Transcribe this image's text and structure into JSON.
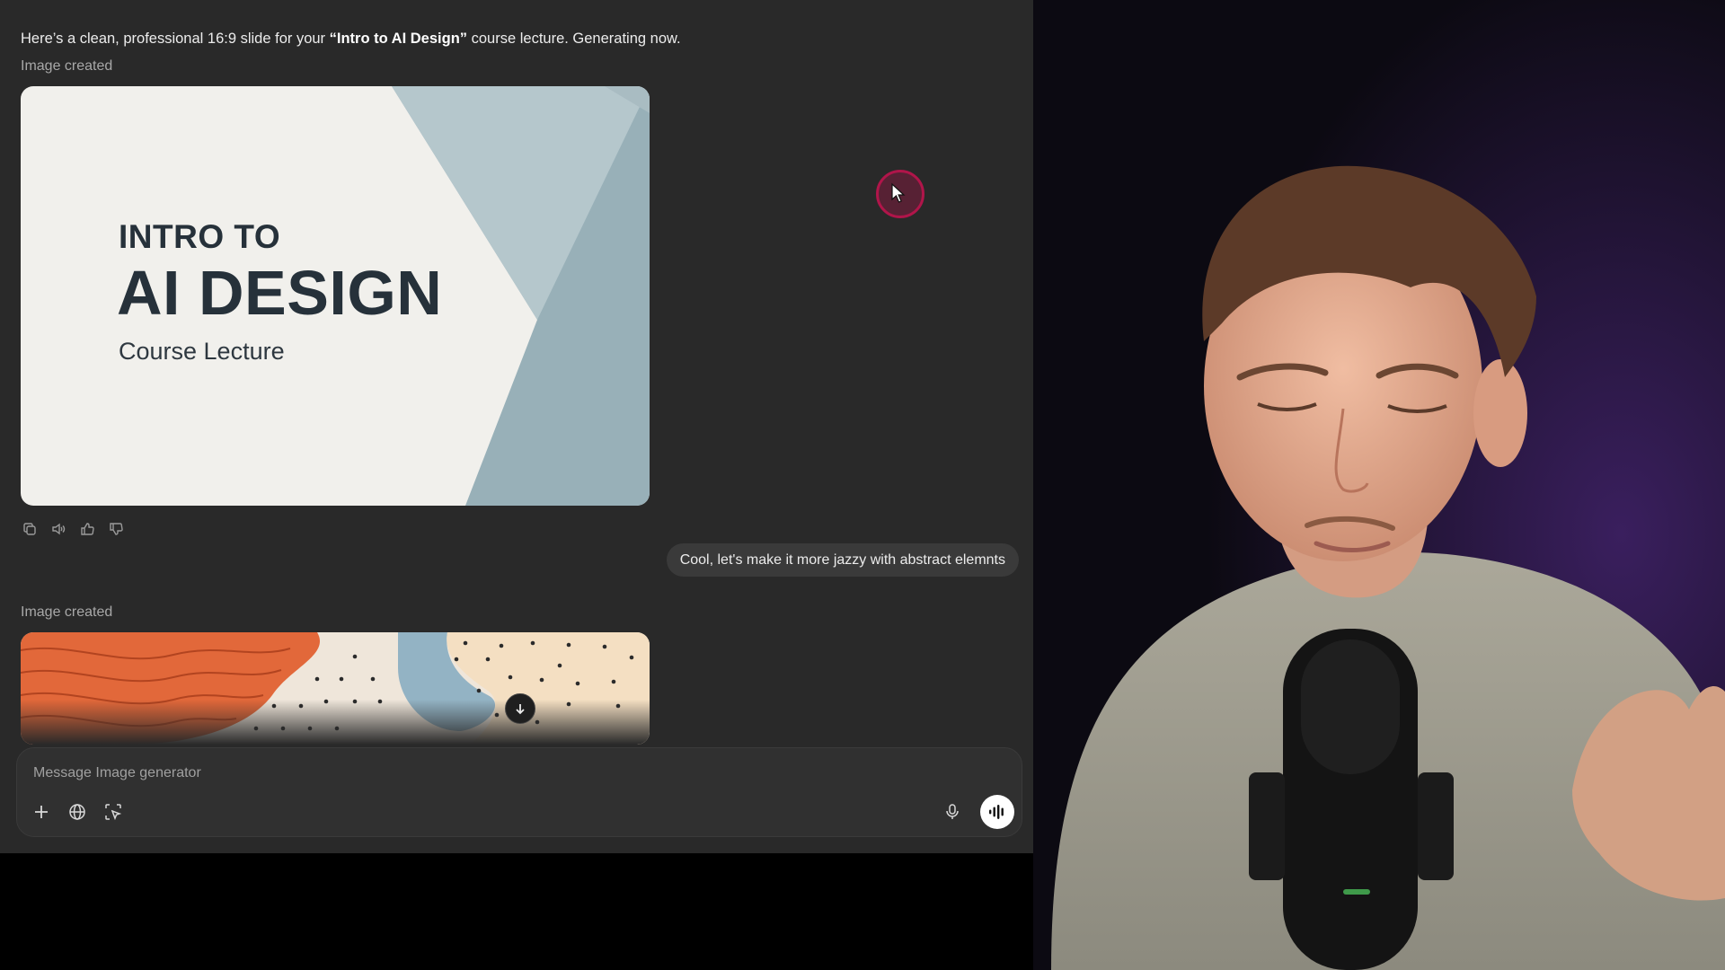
{
  "conversation": {
    "intro_before": "Here’s a clean, professional 16:9 slide for your ",
    "intro_bold": "“Intro to AI Design”",
    "intro_after": " course lecture. Generating now.",
    "image_created_1": "Image created",
    "image_created_2": "Image created",
    "slide": {
      "line1": "INTRO TO",
      "line2": "AI DESIGN",
      "line3": "Course Lecture"
    },
    "user_message": "Cool, let's make it more jazzy with abstract elemnts",
    "actions": [
      {
        "name": "copy",
        "icon": "copy-icon"
      },
      {
        "name": "read-aloud",
        "icon": "speaker-icon"
      },
      {
        "name": "good-response",
        "icon": "thumbs-up-icon"
      },
      {
        "name": "bad-response",
        "icon": "thumbs-down-icon"
      }
    ]
  },
  "composer": {
    "placeholder": "Message Image generator",
    "buttons": [
      "plus-icon",
      "globe-icon",
      "select-region-icon",
      "microphone-icon",
      "voice-mode-icon"
    ]
  },
  "colors": {
    "chat_bg": "#292929",
    "slide_bg": "#f1f0ec",
    "slide_text": "#26313a",
    "slide_accent_light": "#b5c7cc",
    "slide_accent_dark": "#98b0b8",
    "abstract_orange": "#e2683a",
    "abstract_blue": "#93b3c4",
    "abstract_cream": "#f4dfc2",
    "cursor_ring": "#b0154a"
  }
}
